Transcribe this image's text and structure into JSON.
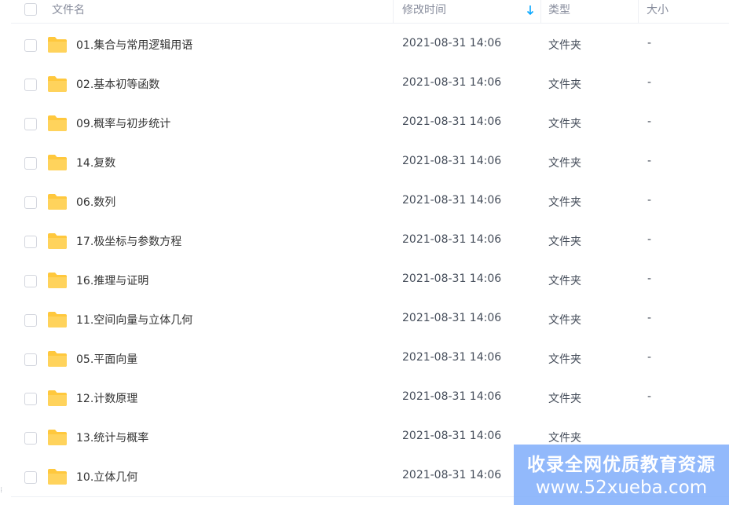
{
  "header": {
    "name_label": "文件名",
    "time_label": "修改时间",
    "type_label": "类型",
    "size_label": "大小"
  },
  "files": [
    {
      "name": "01.集合与常用逻辑用语",
      "time": "2021-08-31 14:06",
      "type": "文件夹",
      "size": "-"
    },
    {
      "name": "02.基本初等函数",
      "time": "2021-08-31 14:06",
      "type": "文件夹",
      "size": "-"
    },
    {
      "name": "09.概率与初步统计",
      "time": "2021-08-31 14:06",
      "type": "文件夹",
      "size": "-"
    },
    {
      "name": "14.复数",
      "time": "2021-08-31 14:06",
      "type": "文件夹",
      "size": "-"
    },
    {
      "name": "06.数列",
      "time": "2021-08-31 14:06",
      "type": "文件夹",
      "size": "-"
    },
    {
      "name": "17.极坐标与参数方程",
      "time": "2021-08-31 14:06",
      "type": "文件夹",
      "size": "-"
    },
    {
      "name": "16.推理与证明",
      "time": "2021-08-31 14:06",
      "type": "文件夹",
      "size": "-"
    },
    {
      "name": "11.空间向量与立体几何",
      "time": "2021-08-31 14:06",
      "type": "文件夹",
      "size": "-"
    },
    {
      "name": "05.平面向量",
      "time": "2021-08-31 14:06",
      "type": "文件夹",
      "size": "-"
    },
    {
      "name": "12.计数原理",
      "time": "2021-08-31 14:06",
      "type": "文件夹",
      "size": "-"
    },
    {
      "name": "13.统计与概率",
      "time": "2021-08-31 14:06",
      "type": "文件夹",
      "size": ""
    },
    {
      "name": "10.立体几何",
      "time": "2021-08-31 14:06",
      "type": "",
      "size": ""
    }
  ],
  "watermark": {
    "line1": "收录全网优质教育资源",
    "line2": "www.52xueba.com"
  },
  "colors": {
    "folder": "#ffc83d",
    "accent": "#06a7ff",
    "watermark_bg": "#7aaafa"
  },
  "icons": {
    "folder": "folder-icon",
    "sort": "arrow-down-icon",
    "checkbox": "checkbox-icon"
  }
}
